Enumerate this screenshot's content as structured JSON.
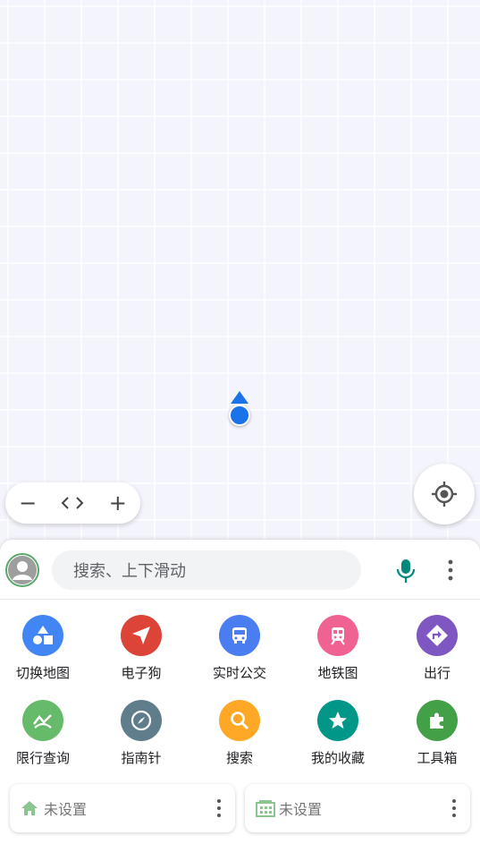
{
  "map": {
    "zoom_out_symbol": "−",
    "code_symbol": "<>",
    "zoom_in_symbol": "+"
  },
  "search": {
    "placeholder": "搜索、上下滑动"
  },
  "tools": [
    {
      "label": "切换地图",
      "icon": "shapes-icon",
      "color": "#4285f4"
    },
    {
      "label": "电子狗",
      "icon": "navigation-arrow-icon",
      "color": "#db4437"
    },
    {
      "label": "实时公交",
      "icon": "bus-icon",
      "color": "#4a7df0"
    },
    {
      "label": "地铁图",
      "icon": "train-icon",
      "color": "#f06292"
    },
    {
      "label": "出行",
      "icon": "turn-right-diamond-icon",
      "color": "#7e57c2"
    },
    {
      "label": "限行查询",
      "icon": "trending-icon",
      "color": "#66bb6a"
    },
    {
      "label": "指南针",
      "icon": "compass-icon",
      "color": "#607d8b"
    },
    {
      "label": "搜索",
      "icon": "search-icon",
      "color": "#ffa726"
    },
    {
      "label": "我的收藏",
      "icon": "star-icon",
      "color": "#009688"
    },
    {
      "label": "工具箱",
      "icon": "puzzle-icon",
      "color": "#43a047"
    }
  ],
  "places": {
    "home": {
      "label": "未设置",
      "icon": "home-icon"
    },
    "work": {
      "label": "未设置",
      "icon": "building-icon"
    }
  }
}
